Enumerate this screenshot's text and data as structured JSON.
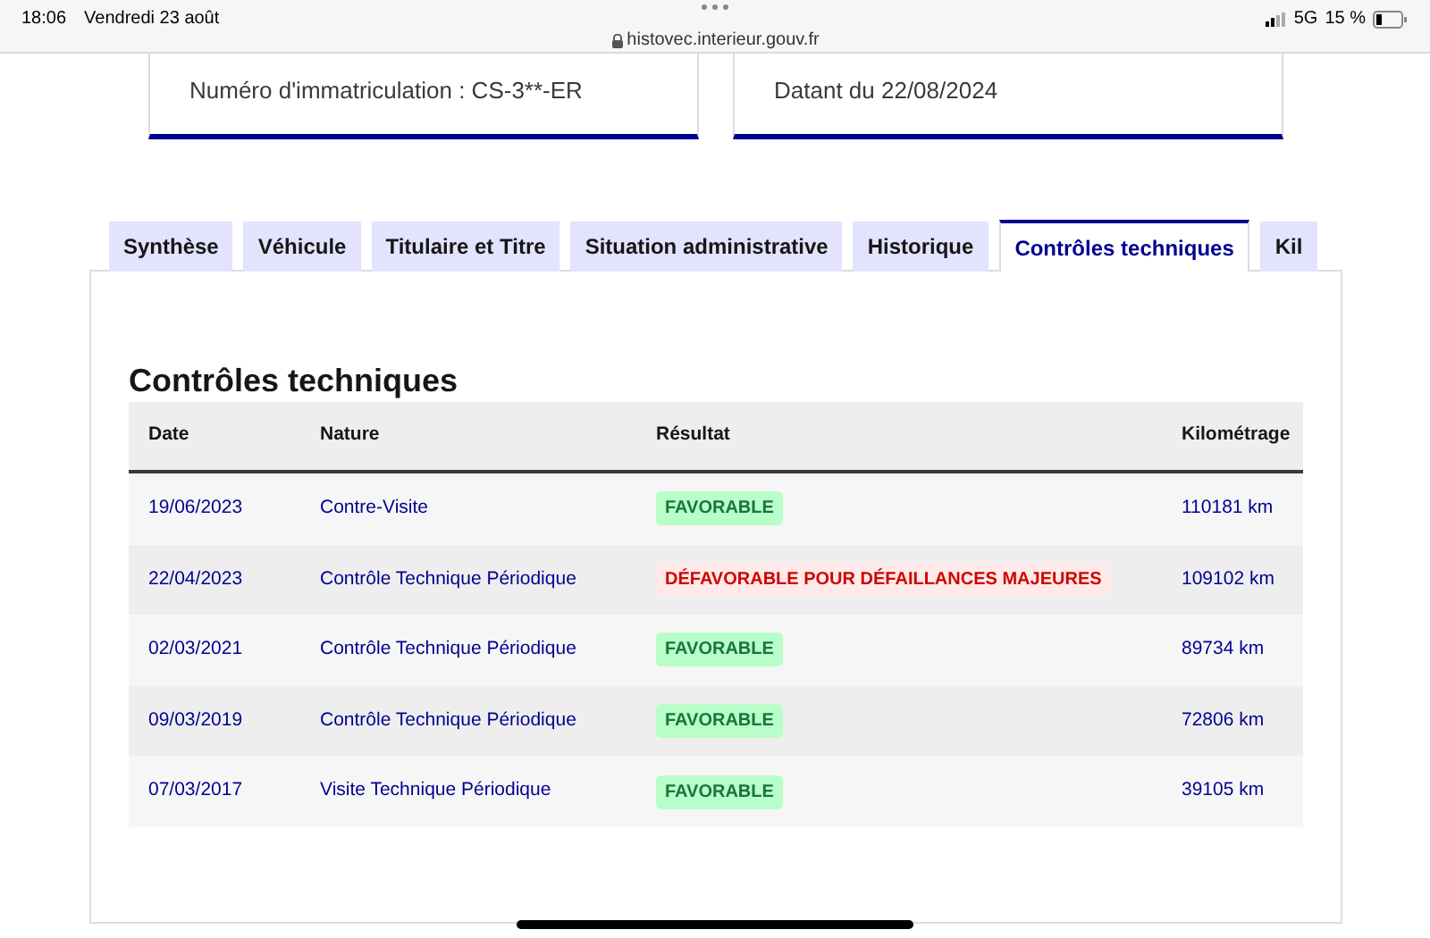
{
  "status_bar": {
    "time": "18:06",
    "date": "Vendredi 23 août",
    "url": "histovec.interieur.gouv.fr",
    "network": "5G",
    "battery": "15 %"
  },
  "cards": [
    {
      "text": "Numéro d'immatriculation : CS-3**-ER"
    },
    {
      "text": "Datant du 22/08/2024"
    }
  ],
  "tabs": [
    {
      "label": "Synthèse",
      "selected": false
    },
    {
      "label": "Véhicule",
      "selected": false
    },
    {
      "label": "Titulaire et Titre",
      "selected": false
    },
    {
      "label": "Situation administrative",
      "selected": false
    },
    {
      "label": "Historique",
      "selected": false
    },
    {
      "label": "Contrôles techniques",
      "selected": true
    },
    {
      "label": "Kil",
      "selected": false
    }
  ],
  "section_title": "Contrôles techniques",
  "table": {
    "columns": [
      "Date",
      "Nature",
      "Résultat",
      "Kilométrage"
    ],
    "rows": [
      {
        "date": "19/06/2023",
        "nature": "Contre-Visite",
        "result": {
          "text": "FAVORABLE",
          "kind": "success"
        },
        "mileage": "110181 km"
      },
      {
        "date": "22/04/2023",
        "nature": "Contrôle Technique Périodique",
        "result": {
          "text": "DÉFAVORABLE POUR DÉFAILLANCES MAJEURES",
          "kind": "error"
        },
        "mileage": "109102 km"
      },
      {
        "date": "02/03/2021",
        "nature": "Contrôle Technique Périodique",
        "result": {
          "text": "FAVORABLE",
          "kind": "success"
        },
        "mileage": "89734 km"
      },
      {
        "date": "09/03/2019",
        "nature": "Contrôle Technique Périodique",
        "result": {
          "text": "FAVORABLE",
          "kind": "success"
        },
        "mileage": "72806 km"
      },
      {
        "date": "07/03/2017",
        "nature": "Visite Technique Périodique",
        "result": {
          "text": "FAVORABLE",
          "kind": "success"
        },
        "mileage": "39105 km"
      }
    ]
  }
}
